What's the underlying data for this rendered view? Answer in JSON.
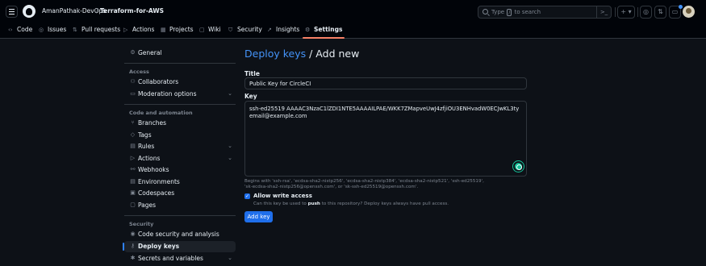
{
  "header": {
    "owner": "AmanPathak-DevOps",
    "separator": "/",
    "repo": "Terraform-for-AWS",
    "search": {
      "placeholder_prefix": "Type",
      "placeholder_key": "/",
      "placeholder_suffix": "to search",
      "command_icon": "command-palette-icon"
    },
    "buttons": [
      {
        "name": "create-new-button",
        "label": "+ ▾"
      },
      {
        "name": "issues-button",
        "icon": "issue-opened-icon"
      },
      {
        "name": "pull-requests-button",
        "icon": "git-pull-request-icon"
      },
      {
        "name": "inbox-button",
        "icon": "inbox-icon"
      }
    ]
  },
  "tabs": [
    {
      "label": "Code",
      "icon": "code-icon"
    },
    {
      "label": "Issues",
      "icon": "issue-opened-icon"
    },
    {
      "label": "Pull requests",
      "icon": "git-pull-request-icon"
    },
    {
      "label": "Actions",
      "icon": "play-icon"
    },
    {
      "label": "Projects",
      "icon": "table-icon"
    },
    {
      "label": "Wiki",
      "icon": "book-icon"
    },
    {
      "label": "Security",
      "icon": "shield-icon"
    },
    {
      "label": "Insights",
      "icon": "graph-icon"
    },
    {
      "label": "Settings",
      "icon": "gear-icon",
      "active": true
    }
  ],
  "sidebar": {
    "general": "General",
    "access_heading": "Access",
    "collaborators": "Collaborators",
    "moderation": "Moderation options",
    "code_heading": "Code and automation",
    "branches": "Branches",
    "tags": "Tags",
    "rules": "Rules",
    "actions": "Actions",
    "webhooks": "Webhooks",
    "environments": "Environments",
    "codespaces": "Codespaces",
    "pages": "Pages",
    "security_heading": "Security",
    "code_security": "Code security and analysis",
    "deploy_keys": "Deploy keys",
    "secrets": "Secrets and variables"
  },
  "main": {
    "title_link": "Deploy keys",
    "title_rest": " / Add new",
    "title_label": "Title",
    "title_value": "Public Key for CircleCI",
    "key_label": "Key",
    "key_line1": "ssh-ed25519 AAAAC3NzaC1lZDI1NTE5AAAAILPAE/WKK7ZMapveUwJ4zfjiOU3ENHvadW0ECJwKL3ty",
    "key_line2": "email@example.com",
    "hint_line1": "Begins with 'ssh-rsa', 'ecdsa-sha2-nistp256', 'ecdsa-sha2-nistp384', 'ecdsa-sha2-nistp521', 'ssh-ed25519',",
    "hint_line2": "'sk-ecdsa-sha2-nistp256@openssh.com', or 'sk-ssh-ed25519@openssh.com'.",
    "write_access_label": "Allow write access",
    "write_access_checked": true,
    "help_prefix": "Can this key be used to ",
    "help_bold": "push",
    "help_suffix": " to this repository? Deploy keys always have pull access.",
    "submit": "Add key"
  },
  "colors": {
    "background": "#0d1117",
    "accent": "#1f6feb",
    "link": "#4493f8",
    "active_tab_underline": "#f78166"
  }
}
